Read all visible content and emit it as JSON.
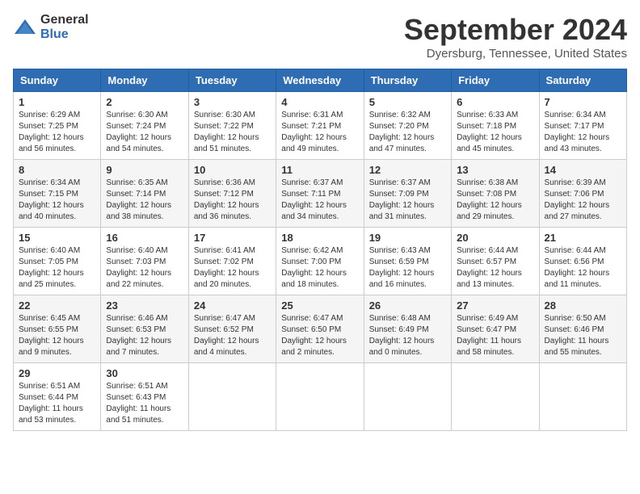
{
  "logo": {
    "general": "General",
    "blue": "Blue"
  },
  "title": "September 2024",
  "location": "Dyersburg, Tennessee, United States",
  "weekdays": [
    "Sunday",
    "Monday",
    "Tuesday",
    "Wednesday",
    "Thursday",
    "Friday",
    "Saturday"
  ],
  "weeks": [
    [
      {
        "day": "1",
        "info": "Sunrise: 6:29 AM\nSunset: 7:25 PM\nDaylight: 12 hours\nand 56 minutes."
      },
      {
        "day": "2",
        "info": "Sunrise: 6:30 AM\nSunset: 7:24 PM\nDaylight: 12 hours\nand 54 minutes."
      },
      {
        "day": "3",
        "info": "Sunrise: 6:30 AM\nSunset: 7:22 PM\nDaylight: 12 hours\nand 51 minutes."
      },
      {
        "day": "4",
        "info": "Sunrise: 6:31 AM\nSunset: 7:21 PM\nDaylight: 12 hours\nand 49 minutes."
      },
      {
        "day": "5",
        "info": "Sunrise: 6:32 AM\nSunset: 7:20 PM\nDaylight: 12 hours\nand 47 minutes."
      },
      {
        "day": "6",
        "info": "Sunrise: 6:33 AM\nSunset: 7:18 PM\nDaylight: 12 hours\nand 45 minutes."
      },
      {
        "day": "7",
        "info": "Sunrise: 6:34 AM\nSunset: 7:17 PM\nDaylight: 12 hours\nand 43 minutes."
      }
    ],
    [
      {
        "day": "8",
        "info": "Sunrise: 6:34 AM\nSunset: 7:15 PM\nDaylight: 12 hours\nand 40 minutes."
      },
      {
        "day": "9",
        "info": "Sunrise: 6:35 AM\nSunset: 7:14 PM\nDaylight: 12 hours\nand 38 minutes."
      },
      {
        "day": "10",
        "info": "Sunrise: 6:36 AM\nSunset: 7:12 PM\nDaylight: 12 hours\nand 36 minutes."
      },
      {
        "day": "11",
        "info": "Sunrise: 6:37 AM\nSunset: 7:11 PM\nDaylight: 12 hours\nand 34 minutes."
      },
      {
        "day": "12",
        "info": "Sunrise: 6:37 AM\nSunset: 7:09 PM\nDaylight: 12 hours\nand 31 minutes."
      },
      {
        "day": "13",
        "info": "Sunrise: 6:38 AM\nSunset: 7:08 PM\nDaylight: 12 hours\nand 29 minutes."
      },
      {
        "day": "14",
        "info": "Sunrise: 6:39 AM\nSunset: 7:06 PM\nDaylight: 12 hours\nand 27 minutes."
      }
    ],
    [
      {
        "day": "15",
        "info": "Sunrise: 6:40 AM\nSunset: 7:05 PM\nDaylight: 12 hours\nand 25 minutes."
      },
      {
        "day": "16",
        "info": "Sunrise: 6:40 AM\nSunset: 7:03 PM\nDaylight: 12 hours\nand 22 minutes."
      },
      {
        "day": "17",
        "info": "Sunrise: 6:41 AM\nSunset: 7:02 PM\nDaylight: 12 hours\nand 20 minutes."
      },
      {
        "day": "18",
        "info": "Sunrise: 6:42 AM\nSunset: 7:00 PM\nDaylight: 12 hours\nand 18 minutes."
      },
      {
        "day": "19",
        "info": "Sunrise: 6:43 AM\nSunset: 6:59 PM\nDaylight: 12 hours\nand 16 minutes."
      },
      {
        "day": "20",
        "info": "Sunrise: 6:44 AM\nSunset: 6:57 PM\nDaylight: 12 hours\nand 13 minutes."
      },
      {
        "day": "21",
        "info": "Sunrise: 6:44 AM\nSunset: 6:56 PM\nDaylight: 12 hours\nand 11 minutes."
      }
    ],
    [
      {
        "day": "22",
        "info": "Sunrise: 6:45 AM\nSunset: 6:55 PM\nDaylight: 12 hours\nand 9 minutes."
      },
      {
        "day": "23",
        "info": "Sunrise: 6:46 AM\nSunset: 6:53 PM\nDaylight: 12 hours\nand 7 minutes."
      },
      {
        "day": "24",
        "info": "Sunrise: 6:47 AM\nSunset: 6:52 PM\nDaylight: 12 hours\nand 4 minutes."
      },
      {
        "day": "25",
        "info": "Sunrise: 6:47 AM\nSunset: 6:50 PM\nDaylight: 12 hours\nand 2 minutes."
      },
      {
        "day": "26",
        "info": "Sunrise: 6:48 AM\nSunset: 6:49 PM\nDaylight: 12 hours\nand 0 minutes."
      },
      {
        "day": "27",
        "info": "Sunrise: 6:49 AM\nSunset: 6:47 PM\nDaylight: 11 hours\nand 58 minutes."
      },
      {
        "day": "28",
        "info": "Sunrise: 6:50 AM\nSunset: 6:46 PM\nDaylight: 11 hours\nand 55 minutes."
      }
    ],
    [
      {
        "day": "29",
        "info": "Sunrise: 6:51 AM\nSunset: 6:44 PM\nDaylight: 11 hours\nand 53 minutes."
      },
      {
        "day": "30",
        "info": "Sunrise: 6:51 AM\nSunset: 6:43 PM\nDaylight: 11 hours\nand 51 minutes."
      },
      {
        "day": "",
        "info": ""
      },
      {
        "day": "",
        "info": ""
      },
      {
        "day": "",
        "info": ""
      },
      {
        "day": "",
        "info": ""
      },
      {
        "day": "",
        "info": ""
      }
    ]
  ]
}
